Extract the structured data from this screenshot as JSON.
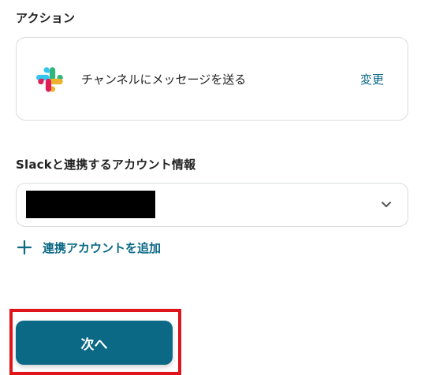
{
  "action_section": {
    "label": "アクション",
    "action_name": "チャンネルにメッセージを送る",
    "change_label": "変更",
    "app_icon": "slack-icon"
  },
  "account_section": {
    "label": "Slackと連携するアカウント情報",
    "selected_value_redacted": true,
    "add_account_label": "連携アカウントを追加"
  },
  "footer": {
    "next_label": "次へ"
  },
  "colors": {
    "accent": "#0b6985",
    "highlight": "#e0141b",
    "border": "#d9dcdf"
  }
}
